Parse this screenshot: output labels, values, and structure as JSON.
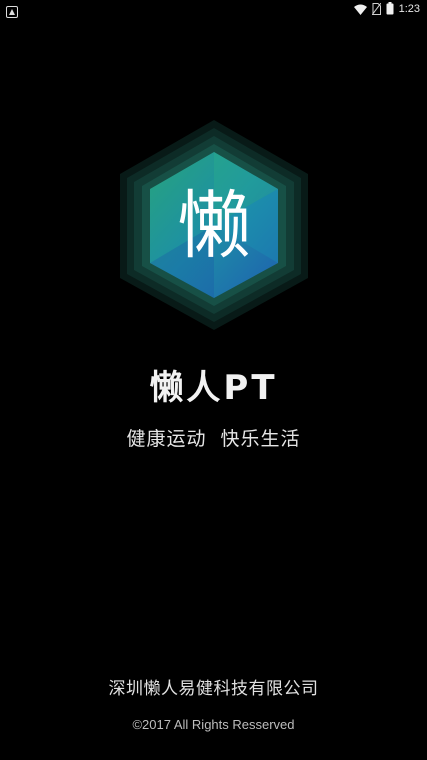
{
  "status_bar": {
    "time": "1:23",
    "icons": [
      "notification-icon",
      "wifi-icon",
      "no-sim-icon",
      "battery-icon"
    ]
  },
  "splash": {
    "logo": {
      "glyph": "懒",
      "colors": {
        "outer_dark": "#0a1f1c",
        "mid_teal": "#12463f",
        "inner_teal": "#1b7a66",
        "face_green": "#2aa37e",
        "face_blue": "#1f6fb0",
        "face_cyan": "#1fa3b8"
      }
    },
    "app_name": "懒人PT",
    "tagline": "健康运动  快乐生活"
  },
  "footer": {
    "company": "深圳懒人易健科技有限公司",
    "copyright": "©2017 All Rights Resserved"
  }
}
